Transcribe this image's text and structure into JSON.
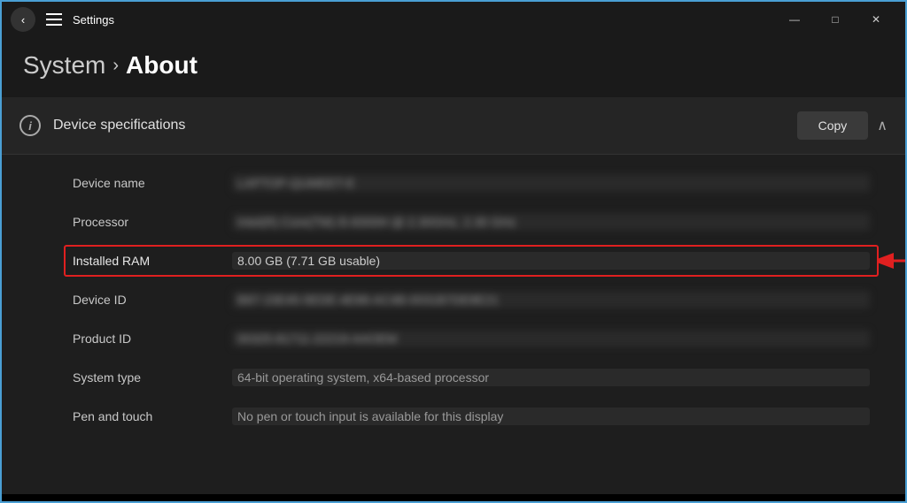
{
  "titlebar": {
    "title": "Settings",
    "minimize_label": "—",
    "maximize_label": "□",
    "close_label": "✕"
  },
  "breadcrumb": {
    "system": "System",
    "chevron": "›",
    "about": "About"
  },
  "section": {
    "icon_label": "i",
    "title": "Device specifications",
    "copy_button": "Copy",
    "chevron_up": "∧"
  },
  "specs": [
    {
      "label": "Device name",
      "value": "LAPTOP-QUMEET-E",
      "blurred": true
    },
    {
      "label": "Processor",
      "value": "Intel(R) Core(TM) i5-8300H @ 2.30GHz, 2.30 GHz",
      "blurred": true
    },
    {
      "label": "Installed RAM",
      "value": "8.00 GB (7.71 GB usable)",
      "blurred": false,
      "highlighted": true
    },
    {
      "label": "Device ID",
      "value": "B87-15E45-5EDE-4E88-AC4B-0031B7DE8E21",
      "blurred": true
    },
    {
      "label": "Product ID",
      "value": "00325-81711-22219-AAOEM",
      "blurred": true
    },
    {
      "label": "System type",
      "value": "64-bit operating system, x64-based processor",
      "blurred": false
    },
    {
      "label": "Pen and touch",
      "value": "No pen or touch input is available for this display",
      "blurred": false
    }
  ]
}
